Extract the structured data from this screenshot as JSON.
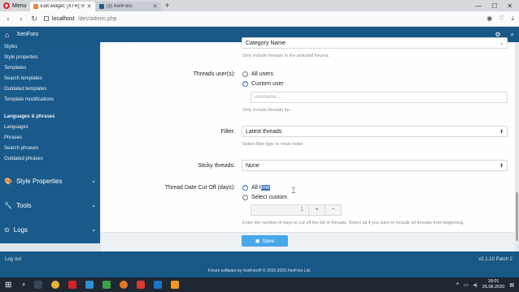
{
  "browser": {
    "menu_label": "Menu",
    "tabs": [
      {
        "title": "Edit widget: [XTR] Style Pr...",
        "favicon": "xenforo-admin-icon",
        "active": true
      },
      {
        "title": "(3) XenForo",
        "favicon": "xenforo-icon",
        "active": false
      }
    ],
    "url": "localhost",
    "url_path": "/dev/admin.php"
  },
  "header": {
    "brand": "XenForo"
  },
  "sidebar": {
    "items_top": [
      "Styles",
      "Style properties",
      "Templates",
      "Search templates",
      "Outdated templates",
      "Template modifications"
    ],
    "lang_heading": "Languages & phrases",
    "items_lang": [
      "Languages",
      "Phrases",
      "Search phrases",
      "Outdated phrases"
    ],
    "sections": [
      {
        "label": "Style Properties",
        "icon": "palette-icon"
      },
      {
        "label": "Tools",
        "icon": "wrench-icon"
      },
      {
        "label": "Logs",
        "icon": "logs-icon"
      }
    ]
  },
  "form": {
    "category_value": "Category Name",
    "category_hint": "Only include threads in the selected forums.",
    "threads_users_label": "Threads user(s):",
    "opt_all_users": "All users",
    "opt_custom_user": "Custom user",
    "username_placeholder": "username...",
    "threads_users_hint": "Only include threads by...",
    "filter_label": "Filter:",
    "filter_value": "Latest threads",
    "filter_hint": "Select filter type to news ticker.",
    "sticky_label": "Sticky threads:",
    "sticky_value": "None",
    "cutoff_label": "Thread Date Cut Off (days):",
    "opt_all_time_a": "All t",
    "opt_all_time_b": "ime",
    "opt_select_custom": "Select custom",
    "stepper_value": "1",
    "stepper_plus": "+",
    "stepper_minus": "−",
    "cutoff_hint": "Enter the number of days to cut off the list of threads. Select all if you want to include all threads from beginning.",
    "save_label": "Save"
  },
  "footer": {
    "logout": "Log out",
    "version": "v2.1.10 Patch 2",
    "copyright": "Forum software by XenForo® © 2010-2020 XenForo Ltd."
  },
  "taskbar": {
    "time": "18:01",
    "date": "25.06.2020"
  }
}
